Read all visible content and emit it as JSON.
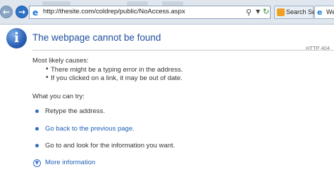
{
  "browser": {
    "url": "http://thesite.com/coldrep/public/NoAccess.aspx",
    "tabs": [
      {
        "label": "Search Ser..."
      },
      {
        "label": "We"
      }
    ]
  },
  "page": {
    "title": "The webpage cannot be found",
    "status_code": "HTTP 404",
    "causes_heading": "Most likely causes:",
    "causes": [
      "There might be a typing error in the address.",
      "If you clicked on a link, it may be out of date."
    ],
    "actions_heading": "What you can try:",
    "actions": [
      {
        "text": "Retype the address."
      },
      {
        "text": "Go back to the previous page."
      },
      {
        "text": "Go to  and look for the information you want."
      }
    ],
    "more_info": "More information"
  },
  "icons": {
    "back": "back-arrow-icon",
    "forward": "forward-arrow-icon",
    "info": "info-icon",
    "search": "search-icon",
    "refresh": "refresh-icon",
    "more": "chevron-down-circle-icon"
  },
  "colors": {
    "title": "#1f4e9e",
    "link": "#1f5fb8",
    "chrome": "#dfe6ee"
  }
}
